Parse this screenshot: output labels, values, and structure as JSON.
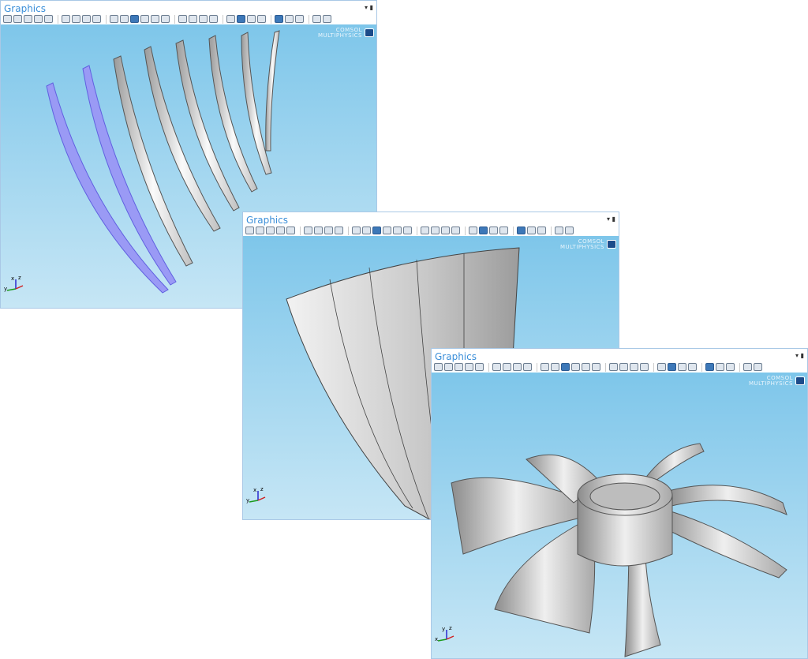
{
  "windows": [
    {
      "title": "Graphics",
      "logo_line1": "COMSOL",
      "logo_line2": "MULTIPHYSICS",
      "axes": [
        "y",
        "x",
        "z"
      ]
    },
    {
      "title": "Graphics",
      "logo_line1": "COMSOL",
      "logo_line2": "MULTIPHYSICS",
      "axes": [
        "y",
        "x",
        "z"
      ]
    },
    {
      "title": "Graphics",
      "logo_line1": "COMSOL",
      "logo_line2": "MULTIPHYSICS",
      "axes": [
        "x",
        "y",
        "z"
      ]
    }
  ],
  "toolbar_icons": [
    "zoom-in",
    "zoom-out",
    "zoom-box",
    "center",
    "zoom-extents",
    "|",
    "axis-view-dropdown",
    "xy-plane",
    "yz-plane",
    "zx-plane",
    "|",
    "transparency",
    "wireframe-render",
    "render-shaded",
    "scene-light",
    "headlight",
    "hide-selected",
    "|",
    "select-all",
    "select-objects",
    "box-select",
    "clear-selection",
    "|",
    "hide",
    "show-toolbar",
    "show-legend",
    "reset",
    "|",
    "view-active",
    "view-multi",
    "view-grid",
    "|",
    "camera-snapshot",
    "print"
  ],
  "toolbar_active": [
    "render-shaded",
    "show-toolbar",
    "view-active"
  ],
  "colors": {
    "title": "#3b8fd9",
    "selected_blade": "#8f8ff0",
    "background_top": "#7ec6ea",
    "background_bottom": "#c6e6f5"
  }
}
